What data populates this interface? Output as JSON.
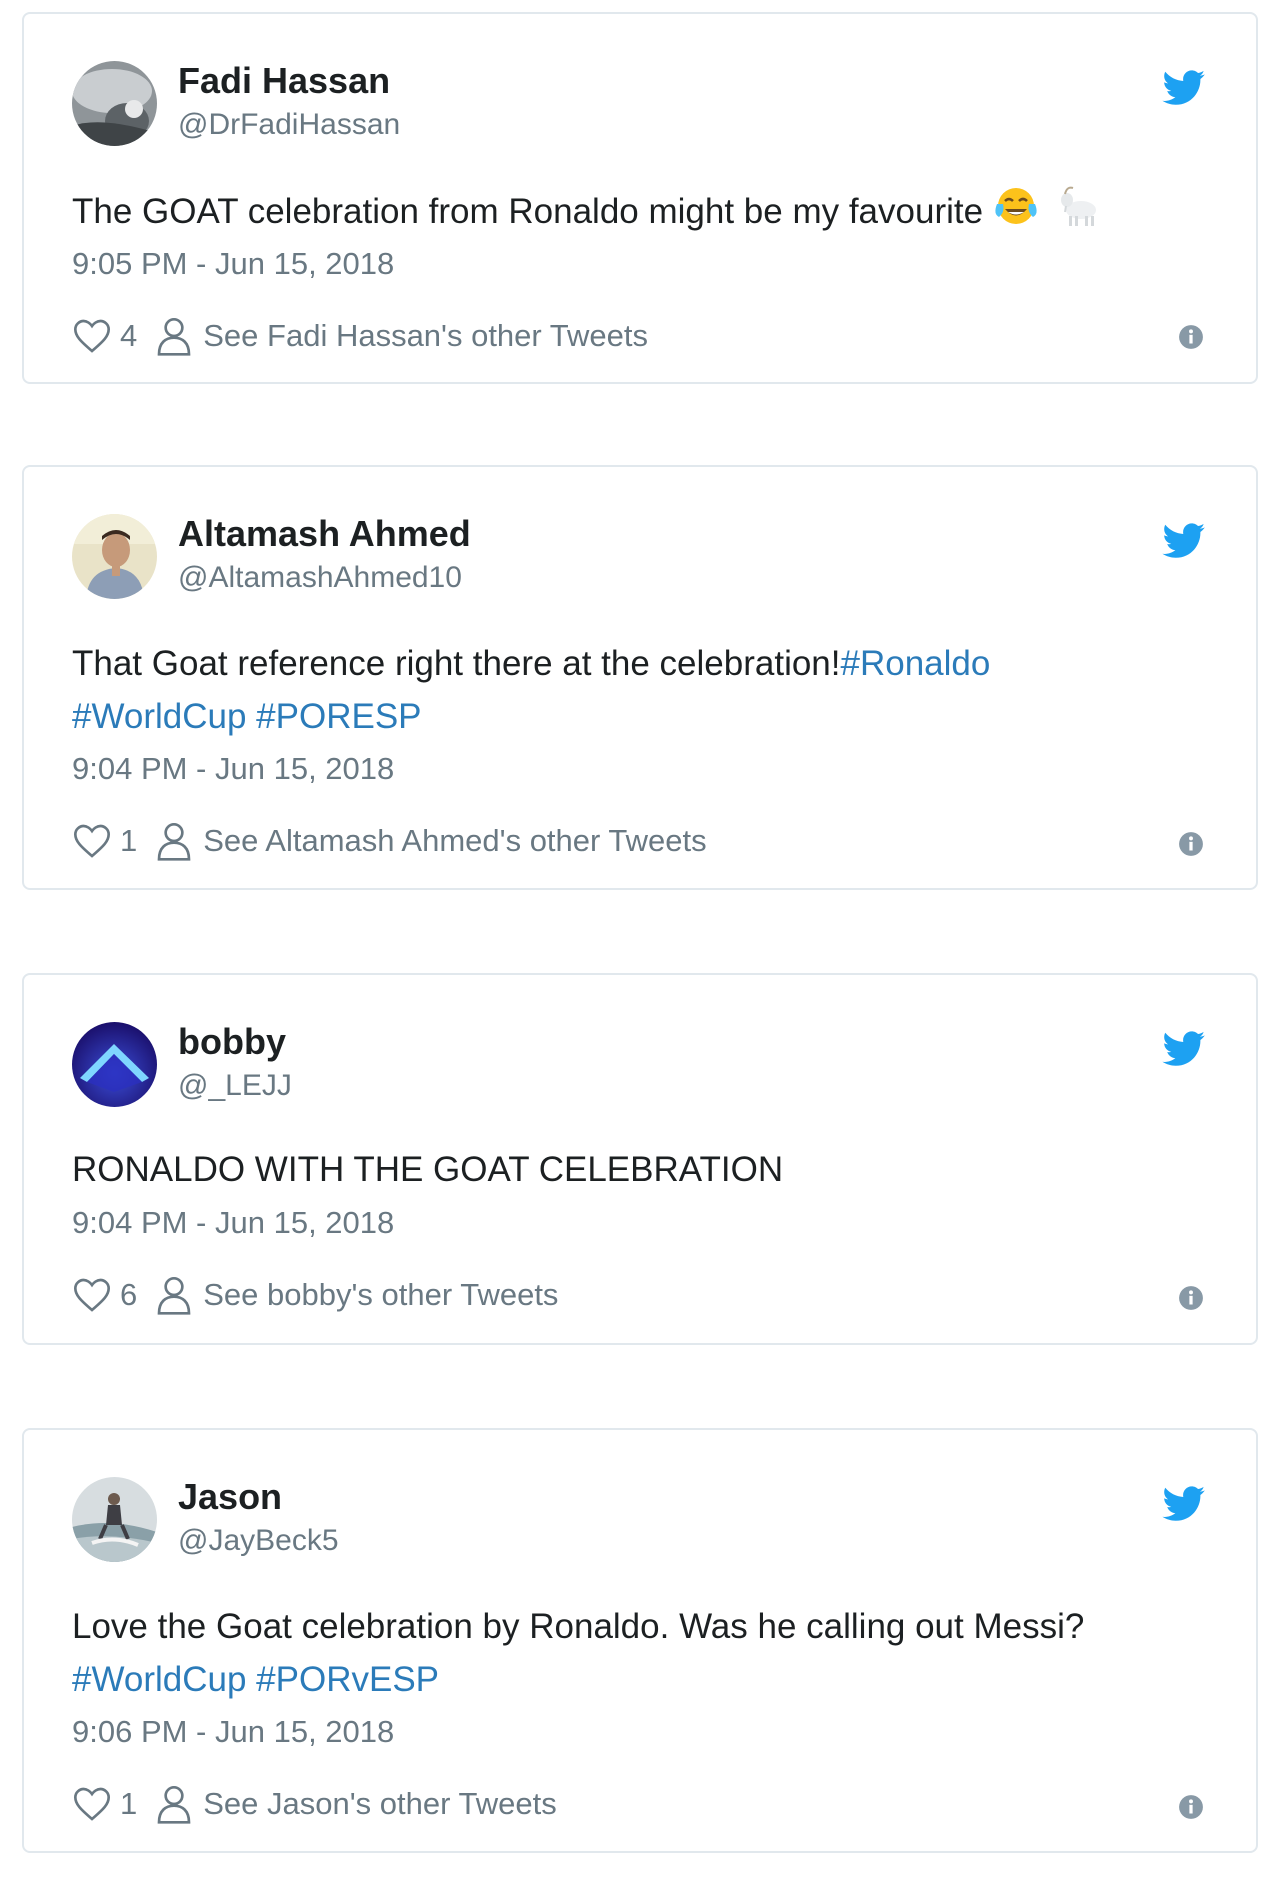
{
  "tweets": [
    {
      "name": "Fadi Hassan",
      "handle": "@DrFadiHassan",
      "text": "The GOAT celebration from Ronaldo might be my favourite",
      "emoji": [
        "face-with-tears-of-joy-icon",
        "goat-icon"
      ],
      "time": "9:05 PM - Jun 15, 2018",
      "likes": "4",
      "see_other": "See Fadi Hassan's other Tweets"
    },
    {
      "name": "Altamash Ahmed",
      "handle": "@AltamashAhmed10",
      "text_main": "That Goat reference right there at the celebration!",
      "hashtags": [
        "#Ronaldo",
        "#WorldCup",
        "#PORESP"
      ],
      "time": "9:04 PM - Jun 15, 2018",
      "likes": "1",
      "see_other": "See Altamash Ahmed's other Tweets"
    },
    {
      "name": "bobby",
      "handle": "@_LEJJ",
      "text": "RONALDO WITH THE GOAT CELEBRATION",
      "time": "9:04 PM - Jun 15, 2018",
      "likes": "6",
      "see_other": "See bobby's other Tweets"
    },
    {
      "name": "Jason",
      "handle": "@JayBeck5",
      "text_main": "Love the Goat celebration by Ronaldo. Was he calling out Messi?",
      "hashtags": [
        "#WorldCup",
        "#PORvESP"
      ],
      "time": "9:06 PM - Jun 15, 2018",
      "likes": "1",
      "see_other": "See Jason's other Tweets"
    }
  ],
  "colors": {
    "border": "#e1e8ed",
    "text": "#1c2022",
    "muted": "#697882",
    "link": "#2b7bb9",
    "twitter_blue": "#1da1f2"
  },
  "icons": {
    "brand": "twitter-bird-icon",
    "like": "heart-icon",
    "profile": "person-icon",
    "info": "info-icon"
  }
}
